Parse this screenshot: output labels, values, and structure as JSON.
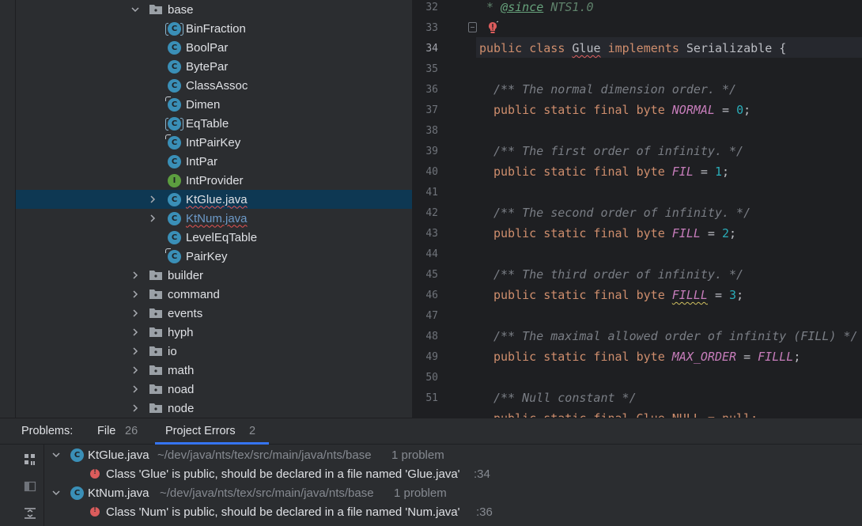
{
  "tree": {
    "items": [
      {
        "label": "base"
      },
      {
        "label": "BinFraction"
      },
      {
        "label": "BoolPar"
      },
      {
        "label": "BytePar"
      },
      {
        "label": "ClassAssoc"
      },
      {
        "label": "Dimen"
      },
      {
        "label": "EqTable"
      },
      {
        "label": "IntPairKey"
      },
      {
        "label": "IntPar"
      },
      {
        "label": "IntProvider"
      },
      {
        "label": "KtGlue.java"
      },
      {
        "label": "KtNum.java"
      },
      {
        "label": "LevelEqTable"
      },
      {
        "label": "PairKey"
      },
      {
        "label": "builder"
      },
      {
        "label": "command"
      },
      {
        "label": "events"
      },
      {
        "label": "hyph"
      },
      {
        "label": "io"
      },
      {
        "label": "math"
      },
      {
        "label": "noad"
      },
      {
        "label": "node"
      }
    ],
    "class_icon_letter": "C",
    "interface_icon_letter": "I"
  },
  "editor": {
    "line_numbers": [
      "32",
      "33",
      "34",
      "35",
      "36",
      "37",
      "38",
      "39",
      "40",
      "41",
      "42",
      "43",
      "44",
      "45",
      "46",
      "47",
      "48",
      "49",
      "50",
      "51"
    ],
    "line32": {
      "star": " * ",
      "tag": "@since",
      "rest": " NTS1.0"
    },
    "line34": {
      "kw1": "public",
      "kw2": "class",
      "name": "Glue",
      "kw3": "implements",
      "iface": "Serializable",
      "brace": " {"
    },
    "decl_kw": "public static final byte",
    "comments": [
      "/** The normal dimension order. */",
      "/** The first order of infinity. */",
      "/** The second order of infinity. */",
      "/** The third order of infinity. */",
      "/** The maximal allowed order of infinity (FILL) */",
      "/** Null constant */"
    ],
    "consts": [
      {
        "name": "NORMAL",
        "eq": " = ",
        "value": "0",
        "end": ";"
      },
      {
        "name": "FIL",
        "eq": " = ",
        "value": "1",
        "end": ";"
      },
      {
        "name": "FILL",
        "eq": " = ",
        "value": "2",
        "end": ";"
      },
      {
        "name": "FILLL",
        "eq": " = ",
        "value": "3",
        "end": ";"
      },
      {
        "name": "MAX_ORDER",
        "eq": " = ",
        "value": "FILLL",
        "end": ";"
      }
    ],
    "partial_line": "public static final Glue NULL = null;"
  },
  "problems": {
    "title": "Problems:",
    "tabs": [
      {
        "label": "File",
        "count": "26"
      },
      {
        "label": "Project Errors",
        "count": "2"
      }
    ],
    "files": [
      {
        "name": "KtGlue.java",
        "path": "~/dev/java/nts/tex/src/main/java/nts/base",
        "count": "1 problem",
        "error": "Class 'Glue' is public, should be declared in a file named 'Glue.java'",
        "line": ":34"
      },
      {
        "name": "KtNum.java",
        "path": "~/dev/java/nts/tex/src/main/java/nts/base",
        "count": "1 problem",
        "error": "Class 'Num' is public, should be declared in a file named 'Num.java'",
        "line": ":36"
      }
    ]
  },
  "colors": {
    "selection": "#0e3853",
    "class_icon": "#3a8fb7",
    "interface_icon": "#5c9e3f",
    "keyword": "#cf8e6d",
    "constant": "#c77dbb",
    "number": "#2aacb8",
    "error": "#db5c5c",
    "tab_underline": "#3574f0"
  }
}
